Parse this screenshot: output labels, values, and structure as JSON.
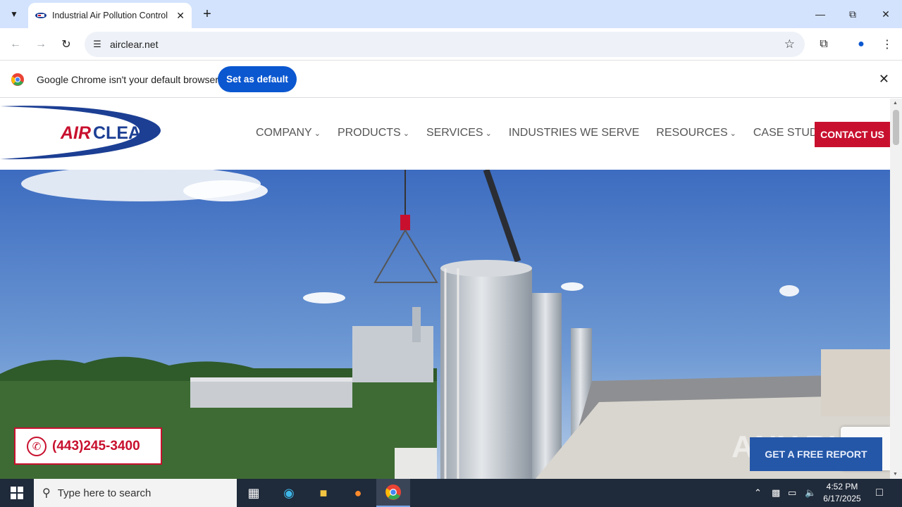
{
  "browser": {
    "tab_title": "Industrial Air Pollution Control",
    "url": "airclear.net",
    "infobar_message": "Google Chrome isn't your default browser",
    "infobar_button": "Set as default"
  },
  "site": {
    "logo_text_air": "AIR",
    "logo_text_clear": "CLEAR",
    "nav": [
      {
        "label": "COMPANY",
        "has_dropdown": true
      },
      {
        "label": "PRODUCTS",
        "has_dropdown": true
      },
      {
        "label": "SERVICES",
        "has_dropdown": true
      },
      {
        "label": "INDUSTRIES WE SERVE",
        "has_dropdown": false
      },
      {
        "label": "RESOURCES",
        "has_dropdown": true
      },
      {
        "label": "CASE STUDIES",
        "has_dropdown": false
      }
    ],
    "contact_button": "CONTACT US",
    "phone": "(443)245-3400",
    "report_button": "GET A FREE REPORT",
    "watermark": "ANY.RUN",
    "brand_colors": {
      "red": "#c8102e",
      "navy": "#1c3f94"
    }
  },
  "taskbar": {
    "search_placeholder": "Type here to search",
    "time": "4:52 PM",
    "date": "6/17/2025"
  }
}
